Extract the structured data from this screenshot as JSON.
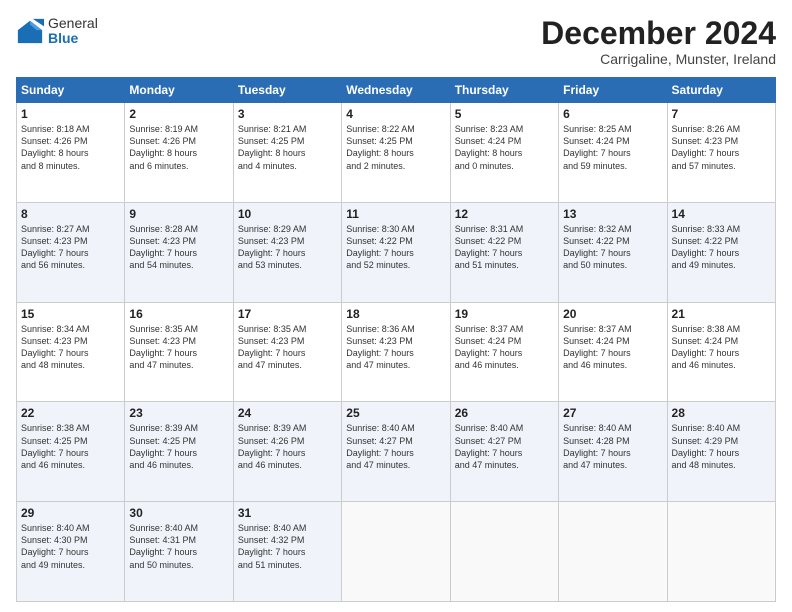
{
  "logo": {
    "general": "General",
    "blue": "Blue"
  },
  "header": {
    "title": "December 2024",
    "subtitle": "Carrigaline, Munster, Ireland"
  },
  "calendar": {
    "days": [
      "Sunday",
      "Monday",
      "Tuesday",
      "Wednesday",
      "Thursday",
      "Friday",
      "Saturday"
    ],
    "weeks": [
      [
        {
          "date": "1",
          "sunrise": "8:18 AM",
          "sunset": "4:26 PM",
          "daylight": "8 hours and 8 minutes."
        },
        {
          "date": "2",
          "sunrise": "8:19 AM",
          "sunset": "4:26 PM",
          "daylight": "8 hours and 6 minutes."
        },
        {
          "date": "3",
          "sunrise": "8:21 AM",
          "sunset": "4:25 PM",
          "daylight": "8 hours and 4 minutes."
        },
        {
          "date": "4",
          "sunrise": "8:22 AM",
          "sunset": "4:25 PM",
          "daylight": "8 hours and 2 minutes."
        },
        {
          "date": "5",
          "sunrise": "8:23 AM",
          "sunset": "4:24 PM",
          "daylight": "8 hours and 0 minutes."
        },
        {
          "date": "6",
          "sunrise": "8:25 AM",
          "sunset": "4:24 PM",
          "daylight": "7 hours and 59 minutes."
        },
        {
          "date": "7",
          "sunrise": "8:26 AM",
          "sunset": "4:23 PM",
          "daylight": "7 hours and 57 minutes."
        }
      ],
      [
        {
          "date": "8",
          "sunrise": "8:27 AM",
          "sunset": "4:23 PM",
          "daylight": "7 hours and 56 minutes."
        },
        {
          "date": "9",
          "sunrise": "8:28 AM",
          "sunset": "4:23 PM",
          "daylight": "7 hours and 54 minutes."
        },
        {
          "date": "10",
          "sunrise": "8:29 AM",
          "sunset": "4:23 PM",
          "daylight": "7 hours and 53 minutes."
        },
        {
          "date": "11",
          "sunrise": "8:30 AM",
          "sunset": "4:22 PM",
          "daylight": "7 hours and 52 minutes."
        },
        {
          "date": "12",
          "sunrise": "8:31 AM",
          "sunset": "4:22 PM",
          "daylight": "7 hours and 51 minutes."
        },
        {
          "date": "13",
          "sunrise": "8:32 AM",
          "sunset": "4:22 PM",
          "daylight": "7 hours and 50 minutes."
        },
        {
          "date": "14",
          "sunrise": "8:33 AM",
          "sunset": "4:22 PM",
          "daylight": "7 hours and 49 minutes."
        }
      ],
      [
        {
          "date": "15",
          "sunrise": "8:34 AM",
          "sunset": "4:23 PM",
          "daylight": "7 hours and 48 minutes."
        },
        {
          "date": "16",
          "sunrise": "8:35 AM",
          "sunset": "4:23 PM",
          "daylight": "7 hours and 47 minutes."
        },
        {
          "date": "17",
          "sunrise": "8:35 AM",
          "sunset": "4:23 PM",
          "daylight": "7 hours and 47 minutes."
        },
        {
          "date": "18",
          "sunrise": "8:36 AM",
          "sunset": "4:23 PM",
          "daylight": "7 hours and 47 minutes."
        },
        {
          "date": "19",
          "sunrise": "8:37 AM",
          "sunset": "4:24 PM",
          "daylight": "7 hours and 46 minutes."
        },
        {
          "date": "20",
          "sunrise": "8:37 AM",
          "sunset": "4:24 PM",
          "daylight": "7 hours and 46 minutes."
        },
        {
          "date": "21",
          "sunrise": "8:38 AM",
          "sunset": "4:24 PM",
          "daylight": "7 hours and 46 minutes."
        }
      ],
      [
        {
          "date": "22",
          "sunrise": "8:38 AM",
          "sunset": "4:25 PM",
          "daylight": "7 hours and 46 minutes."
        },
        {
          "date": "23",
          "sunrise": "8:39 AM",
          "sunset": "4:25 PM",
          "daylight": "7 hours and 46 minutes."
        },
        {
          "date": "24",
          "sunrise": "8:39 AM",
          "sunset": "4:26 PM",
          "daylight": "7 hours and 46 minutes."
        },
        {
          "date": "25",
          "sunrise": "8:40 AM",
          "sunset": "4:27 PM",
          "daylight": "7 hours and 47 minutes."
        },
        {
          "date": "26",
          "sunrise": "8:40 AM",
          "sunset": "4:27 PM",
          "daylight": "7 hours and 47 minutes."
        },
        {
          "date": "27",
          "sunrise": "8:40 AM",
          "sunset": "4:28 PM",
          "daylight": "7 hours and 47 minutes."
        },
        {
          "date": "28",
          "sunrise": "8:40 AM",
          "sunset": "4:29 PM",
          "daylight": "7 hours and 48 minutes."
        }
      ],
      [
        {
          "date": "29",
          "sunrise": "8:40 AM",
          "sunset": "4:30 PM",
          "daylight": "7 hours and 49 minutes."
        },
        {
          "date": "30",
          "sunrise": "8:40 AM",
          "sunset": "4:31 PM",
          "daylight": "7 hours and 50 minutes."
        },
        {
          "date": "31",
          "sunrise": "8:40 AM",
          "sunset": "4:32 PM",
          "daylight": "7 hours and 51 minutes."
        },
        null,
        null,
        null,
        null
      ]
    ]
  }
}
